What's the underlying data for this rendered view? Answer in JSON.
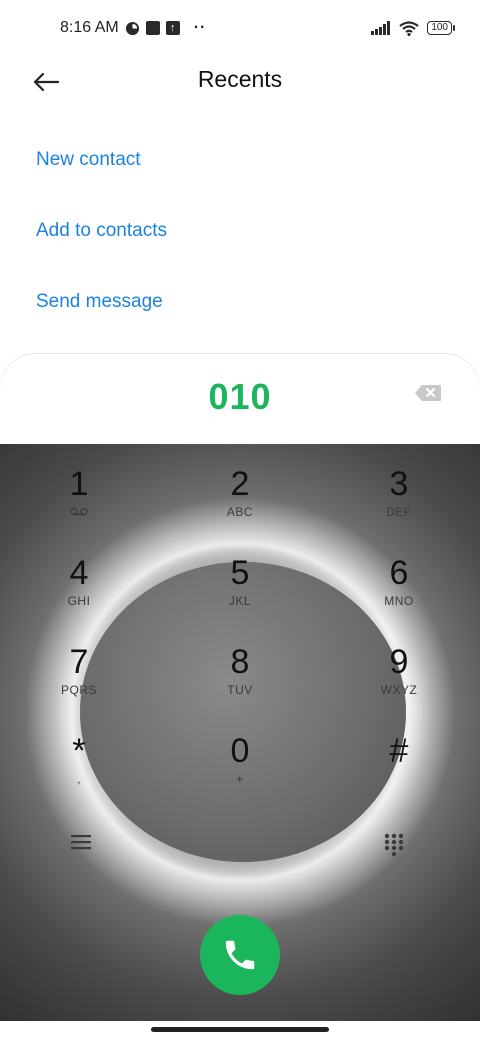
{
  "status_bar": {
    "time": "8:16 AM",
    "battery": "100"
  },
  "header": {
    "title": "Recents"
  },
  "actions": {
    "new_contact": "New contact",
    "add_to_contacts": "Add to contacts",
    "send_message": "Send message"
  },
  "dialer": {
    "number": "010",
    "accent_color": "#1bb55c",
    "keys": [
      {
        "digit": "1",
        "letters": ""
      },
      {
        "digit": "2",
        "letters": "ABC"
      },
      {
        "digit": "3",
        "letters": "DEF"
      },
      {
        "digit": "4",
        "letters": "GHI"
      },
      {
        "digit": "5",
        "letters": "JKL"
      },
      {
        "digit": "6",
        "letters": "MNO"
      },
      {
        "digit": "7",
        "letters": "PQRS"
      },
      {
        "digit": "8",
        "letters": "TUV"
      },
      {
        "digit": "9",
        "letters": "WXYZ"
      },
      {
        "digit": "*",
        "letters": ","
      },
      {
        "digit": "0",
        "letters": "+"
      },
      {
        "digit": "#",
        "letters": ""
      }
    ]
  },
  "icons": {
    "back": "arrow-left-icon",
    "backspace": "backspace-icon",
    "voicemail": "voicemail-icon",
    "menu": "menu-icon",
    "dialpad": "dialpad-icon",
    "call": "phone-icon"
  },
  "link_color": "#1a82e2"
}
